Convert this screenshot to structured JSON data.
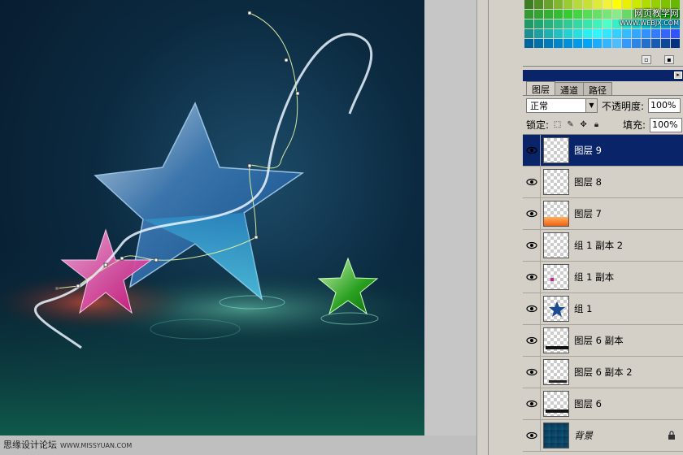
{
  "watermarks": {
    "bottom_left": "思缘设计论坛",
    "bottom_left_url": "WWW.MISSYUAN.COM",
    "top_right": "网页教学网",
    "top_right_url": "WWW.WEBJX.COM"
  },
  "swatches": {
    "colors": [
      "#3e7d24",
      "#4f8f24",
      "#69a22b",
      "#7fb82e",
      "#99cc33",
      "#b6d93b",
      "#c8e035",
      "#dceb37",
      "#f0f23b",
      "#ffff00",
      "#e8f000",
      "#ccea00",
      "#b1dc00",
      "#97d000",
      "#7ec300",
      "#66b800",
      "#339933",
      "#33a333",
      "#33b033",
      "#33bd33",
      "#33cc33",
      "#44d544",
      "#55dd55",
      "#66e066",
      "#77e677",
      "#88ec88",
      "#66d966",
      "#4dcc4d",
      "#33bf33",
      "#1ab21a",
      "#00a500",
      "#009900",
      "#1f9966",
      "#22a671",
      "#26b27d",
      "#2abf88",
      "#2ecc94",
      "#33d9a0",
      "#39e5ab",
      "#40f2b7",
      "#4dffc2",
      "#33f0c6",
      "#22e0c8",
      "#11d1cb",
      "#00c2cc",
      "#00b2cc",
      "#00a3cc",
      "#0093cc",
      "#1e8f8f",
      "#1fa0a0",
      "#20b0b0",
      "#22c0c0",
      "#24d0d0",
      "#26e0e0",
      "#28f0f0",
      "#2ef5ff",
      "#33e6ff",
      "#33d0ff",
      "#33bbff",
      "#33a6ff",
      "#3391ff",
      "#337cff",
      "#3366ff",
      "#3352ff",
      "#006699",
      "#0070a8",
      "#007ab8",
      "#0085c8",
      "#0090d8",
      "#009ae8",
      "#00a5f8",
      "#1aadff",
      "#33b5ff",
      "#4dbdff",
      "#3399ff",
      "#2a85e6",
      "#2070cc",
      "#175cb3",
      "#0d4799",
      "#033380"
    ],
    "new_label": "新",
    "delete_label": "删"
  },
  "layers_panel": {
    "tabs": [
      "图层",
      "通道",
      "路径"
    ],
    "active_tab": 0,
    "blend_mode": "正常",
    "opacity_label": "不透明度:",
    "opacity_value": "100%",
    "lock_label": "锁定:",
    "fill_label": "填充:",
    "fill_value": "100%",
    "layers": [
      {
        "name": "图层 9",
        "selected": true,
        "thumb": "empty"
      },
      {
        "name": "图层 8",
        "selected": false,
        "thumb": "empty"
      },
      {
        "name": "图层 7",
        "selected": false,
        "thumb": "orange"
      },
      {
        "name": "组 1 副本 2",
        "selected": false,
        "thumb": "empty"
      },
      {
        "name": "组 1 副本",
        "selected": false,
        "thumb": "pink-dot"
      },
      {
        "name": "组 1",
        "selected": false,
        "thumb": "blue-star"
      },
      {
        "name": "图层 6 副本",
        "selected": false,
        "thumb": "black-bar"
      },
      {
        "name": "图层 6 副本 2",
        "selected": false,
        "thumb": "black-bar-low"
      },
      {
        "name": "图层 6",
        "selected": false,
        "thumb": "black-bar"
      },
      {
        "name": "背景",
        "selected": false,
        "thumb": "bg",
        "italic": true,
        "locked": true
      }
    ]
  }
}
